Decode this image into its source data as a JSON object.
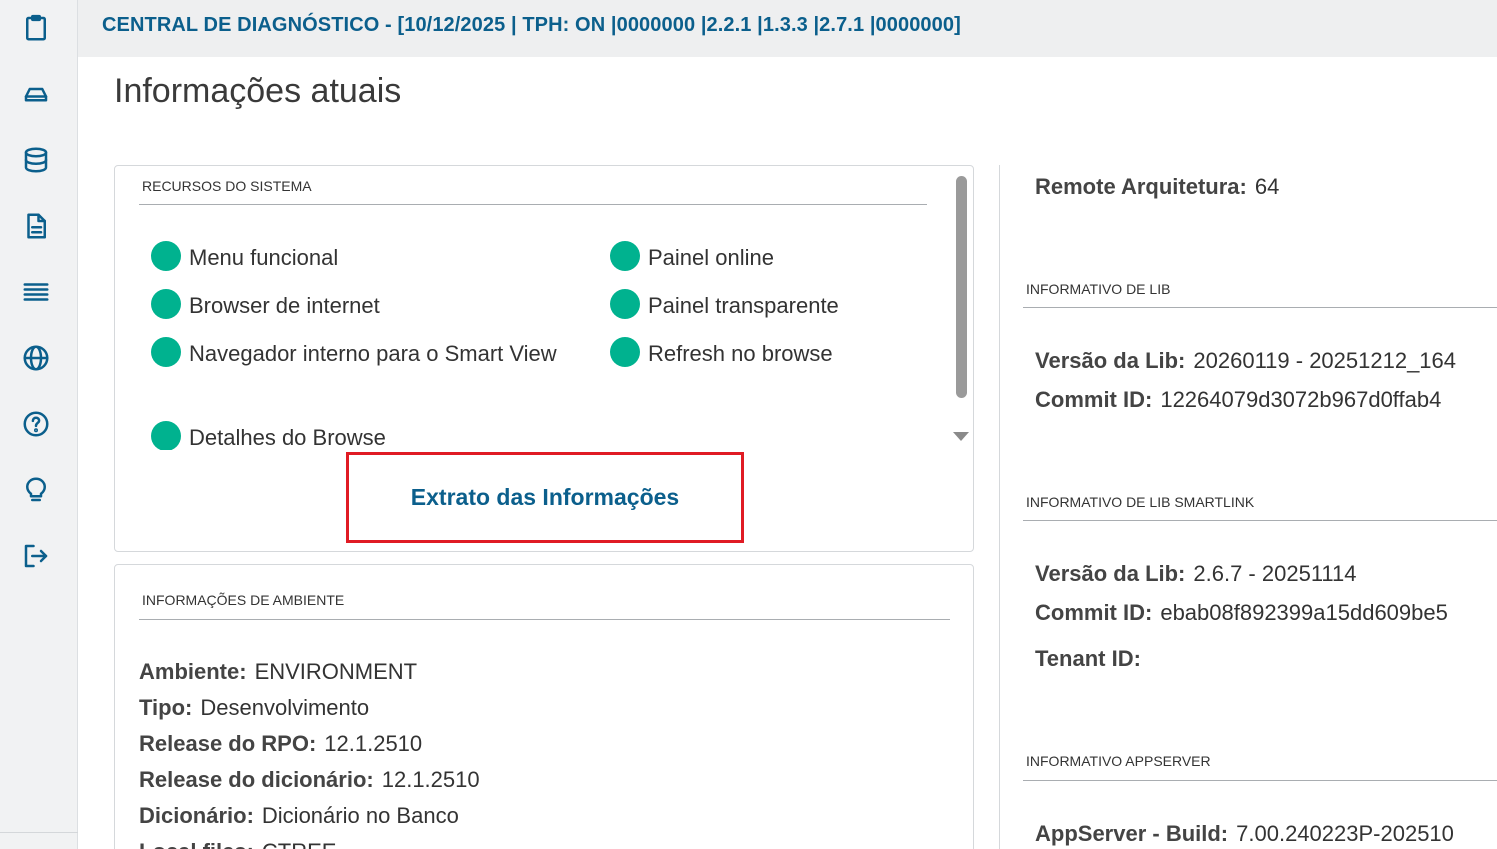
{
  "header": {
    "title": "CENTRAL DE DIAGNÓSTICO - [10/12/2025 | TPH: ON |0000000 |2.2.1 |1.3.3 |2.7.1 |0000000]"
  },
  "page": {
    "title": "Informações atuais"
  },
  "sidebar": {
    "icons": [
      "clipboard-icon",
      "drive-icon",
      "database-icon",
      "document-icon",
      "list-icon",
      "globe-icon",
      "help-icon",
      "lightbulb-icon",
      "logout-icon"
    ]
  },
  "recursos": {
    "title": "RECURSOS DO SISTEMA",
    "left": [
      "Menu funcional",
      "Browser de internet",
      "Navegador interno para o Smart View",
      "Detalhes do Browse"
    ],
    "right": [
      "Painel online",
      "Painel transparente",
      "Refresh no browse"
    ],
    "status_color": "#00b28f",
    "button": "Extrato das Informações"
  },
  "ambiente": {
    "title": "INFORMAÇÕES DE AMBIENTE",
    "rows": [
      {
        "k": "Ambiente:",
        "v": "ENVIRONMENT"
      },
      {
        "k": "Tipo:",
        "v": "Desenvolvimento"
      },
      {
        "k": "Release do RPO:",
        "v": "12.1.2510"
      },
      {
        "k": "Release do dicionário:",
        "v": "12.1.2510"
      },
      {
        "k": "Dicionário:",
        "v": "Dicionário no Banco"
      },
      {
        "k": "Local files:",
        "v": "CTREE"
      }
    ]
  },
  "right": {
    "remote": {
      "k": "Remote Arquitetura:",
      "v": "64"
    },
    "lib": {
      "title": "INFORMATIVO DE LIB",
      "versao": {
        "k": "Versão da Lib:",
        "v": "20260119 - 20251212_164"
      },
      "commit": {
        "k": "Commit ID:",
        "v": "12264079d3072b967d0ffab4"
      }
    },
    "smartlink": {
      "title": "INFORMATIVO DE LIB SMARTLINK",
      "versao": {
        "k": "Versão da Lib:",
        "v": "2.6.7 - 20251114"
      },
      "commit": {
        "k": "Commit ID:",
        "v": "ebab08f892399a15dd609be5"
      },
      "tenant": {
        "k": "Tenant ID:",
        "v": ""
      }
    },
    "appserver": {
      "title": "INFORMATIVO APPSERVER",
      "build": {
        "k": "AppServer - Build:",
        "v": "7.00.240223P-202510"
      }
    }
  }
}
